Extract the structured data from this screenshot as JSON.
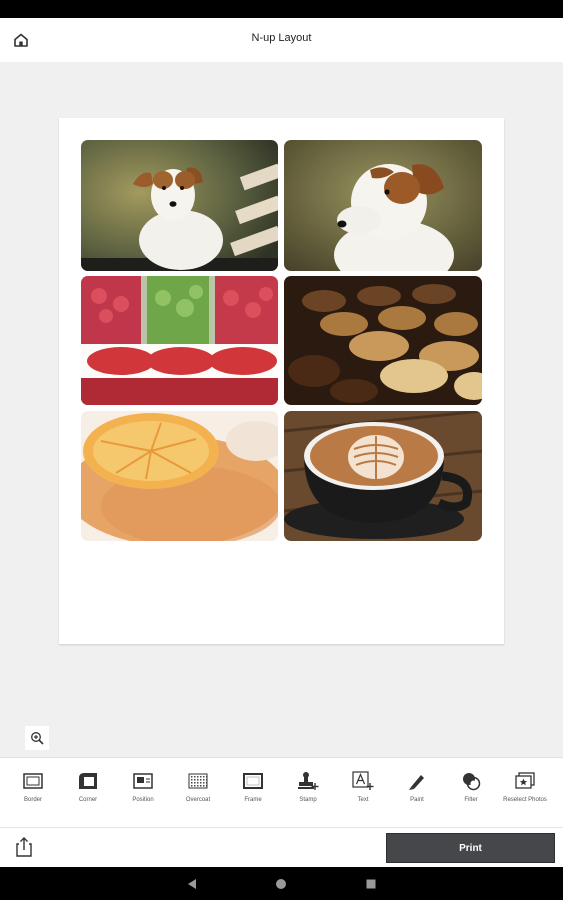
{
  "app": {
    "title": "N-up Layout"
  },
  "icons": {
    "home": "home-icon",
    "zoom": "zoom-in-icon",
    "share": "share-icon"
  },
  "photos": [
    {
      "subject": "dog-on-bench"
    },
    {
      "subject": "dog-portrait"
    },
    {
      "subject": "candy-jars"
    },
    {
      "subject": "tarts"
    },
    {
      "subject": "citrus-pastry"
    },
    {
      "subject": "latte-art"
    }
  ],
  "toolbar": {
    "items": [
      {
        "label": "Border",
        "icon": "border-icon"
      },
      {
        "label": "Corner",
        "icon": "corner-icon"
      },
      {
        "label": "Position",
        "icon": "position-icon"
      },
      {
        "label": "Overcoat",
        "icon": "overcoat-icon"
      },
      {
        "label": "Frame",
        "icon": "frame-icon"
      },
      {
        "label": "Stamp",
        "icon": "stamp-icon"
      },
      {
        "label": "Text",
        "icon": "text-icon"
      },
      {
        "label": "Paint",
        "icon": "paint-icon"
      },
      {
        "label": "Filter",
        "icon": "filter-icon"
      },
      {
        "label": "Reselect Photos",
        "icon": "reselect-photos-icon"
      }
    ]
  },
  "actions": {
    "print_label": "Print"
  },
  "colors": {
    "print_button": "#45474a",
    "status_bar": "#000000",
    "canvas": "#f0f0f0"
  }
}
